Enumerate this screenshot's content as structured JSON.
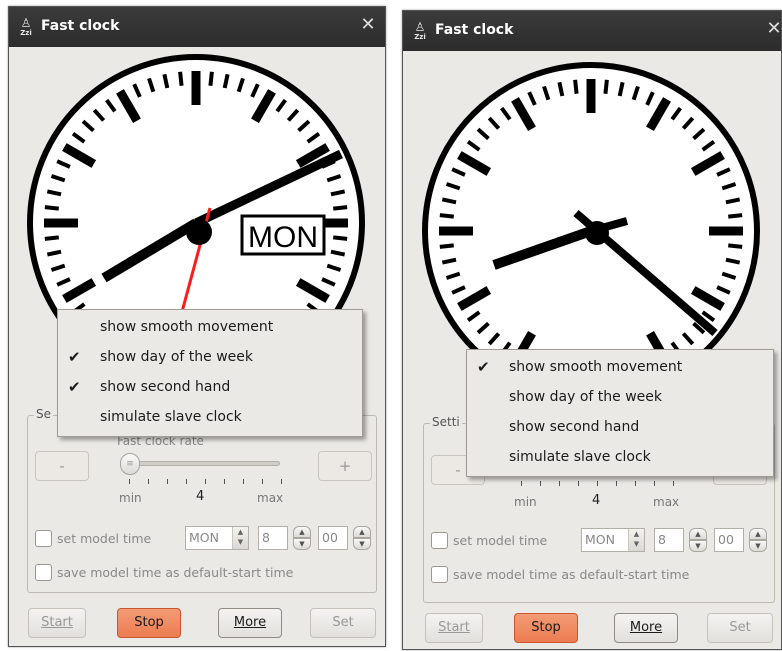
{
  "left": {
    "title": "Fast clock",
    "icon_text": "Zzi",
    "day_label": "MON",
    "settings_legend": "Se",
    "rate_label": "Fast clock rate",
    "minus": "-",
    "plus": "+",
    "tick_min": "min",
    "tick_val": "4",
    "tick_max": "max",
    "set_model_time": "set model time",
    "save_default": "save model time as default-start time",
    "day_value": "MON",
    "hour_value": "8",
    "minute_value": "00",
    "btn_start": "Start",
    "btn_stop": "Stop",
    "btn_more": "More",
    "btn_set": "Set",
    "menu": [
      {
        "label": "show smooth movement",
        "checked": false
      },
      {
        "label": "show day of the week",
        "checked": true
      },
      {
        "label": "show second hand",
        "checked": true
      },
      {
        "label": "simulate slave clock",
        "checked": false
      }
    ]
  },
  "right": {
    "title": "Fast clock",
    "icon_text": "Zzi",
    "settings_legend": "Setti",
    "minus": "-",
    "tick_min": "min",
    "tick_val": "4",
    "tick_max": "max",
    "set_model_time": "set model time",
    "save_default": "save model time as default-start time",
    "day_value": "MON",
    "hour_value": "8",
    "minute_value": "00",
    "btn_start": "Start",
    "btn_stop": "Stop",
    "btn_more": "More",
    "btn_set": "Set",
    "menu": [
      {
        "label": "show smooth movement",
        "checked": true
      },
      {
        "label": "show day of the week",
        "checked": false
      },
      {
        "label": "show second hand",
        "checked": false
      },
      {
        "label": "simulate slave clock",
        "checked": false
      }
    ]
  },
  "check_mark": "✔",
  "close_glyph": "✕",
  "icons": [
    "bell-icon",
    "close-icon",
    "check-icon",
    "slider-handle",
    "spin-arrows-icon"
  ]
}
